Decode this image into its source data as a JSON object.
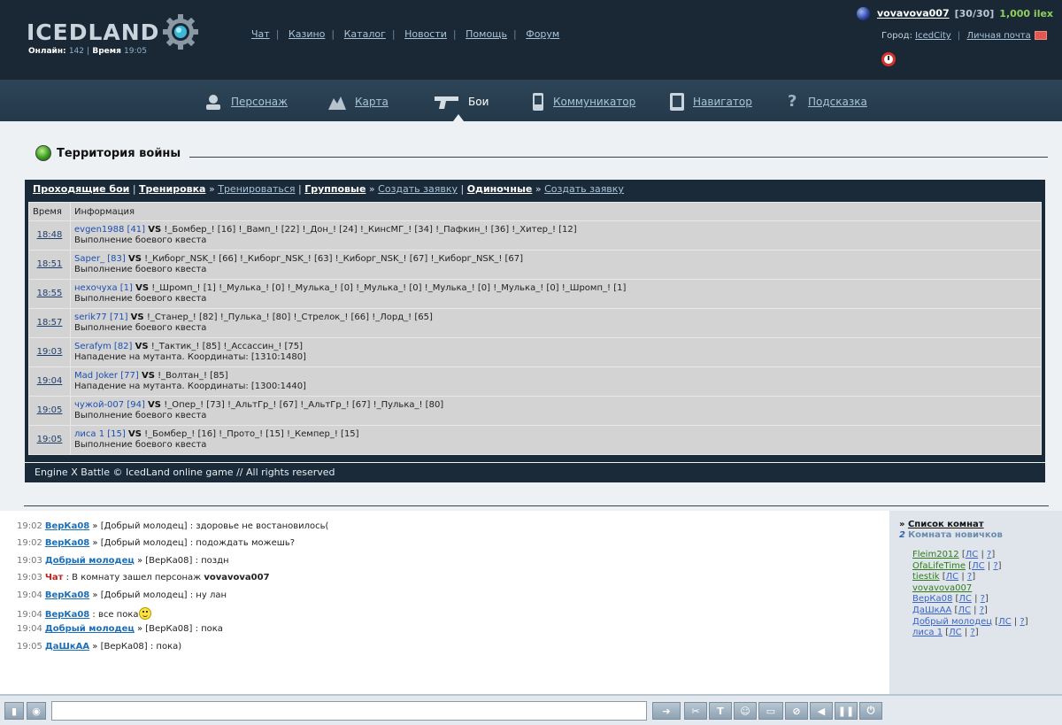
{
  "header": {
    "logo_text": "ICEDLAND",
    "online_label": "Онлайн:",
    "online_count": "142",
    "time_label": "Время",
    "time_value": "19:05",
    "links": [
      "Чат",
      "Казино",
      "Каталог",
      "Новости",
      "Помощь",
      "Форум"
    ],
    "user": {
      "name": "vovavova007",
      "hp": "[30/30]",
      "money": "1,000 ilex",
      "city_label": "Город:",
      "city": "IcedCity",
      "mail_link": "Личная почта"
    }
  },
  "nav": {
    "items": [
      {
        "label": "Персонаж",
        "icon": "character-icon",
        "active": false
      },
      {
        "label": "Карта",
        "icon": "map-icon",
        "active": false
      },
      {
        "label": "Бои",
        "icon": "gun-icon",
        "active": true
      },
      {
        "label": "Коммуникатор",
        "icon": "communicator-icon",
        "active": false
      },
      {
        "label": "Навигатор",
        "icon": "navigator-icon",
        "active": false
      },
      {
        "label": "Подсказка",
        "icon": "help-icon",
        "active": false
      }
    ]
  },
  "main": {
    "title": "Территория войны",
    "tabs": {
      "current": "Проходящие бои",
      "training": "Тренировка",
      "train_link": "Тренироваться",
      "group": "Групповые",
      "group_create": "Создать заявку",
      "single": "Одиночные",
      "single_create": "Создать заявку"
    },
    "table": {
      "headers": [
        "Время",
        "Информация"
      ],
      "rows": [
        {
          "time": "18:48",
          "attacker": "evgen1988 [41]",
          "vs": "VS",
          "defenders": "!_Бомбер_! [16] !_Вамп_! [22] !_Дон_! [24] !_КинсМГ_! [34] !_Пафкин_! [36] !_Хитер_! [12]",
          "desc": "Выполнение боевого квеста"
        },
        {
          "time": "18:51",
          "attacker": "Saper_ [83]",
          "vs": "VS",
          "defenders": "!_Киборг_NSK_! [66] !_Киборг_NSK_! [63] !_Киборг_NSK_! [67] !_Киборг_NSK_! [67]",
          "desc": "Выполнение боевого квеста"
        },
        {
          "time": "18:55",
          "attacker": "нехочуха [1]",
          "vs": "VS",
          "defenders": "!_Шромп_! [1] !_Мулька_! [0] !_Мулька_! [0] !_Мулька_! [0] !_Мулька_! [0] !_Мулька_! [0] !_Шромп_! [1]",
          "desc": "Выполнение боевого квеста"
        },
        {
          "time": "18:57",
          "attacker": "serik77 [71]",
          "vs": "VS",
          "defenders": "!_Станер_! [82] !_Пулька_! [80] !_Стрелок_! [66] !_Лорд_! [65]",
          "desc": "Выполнение боевого квеста"
        },
        {
          "time": "19:03",
          "attacker": "Serafym [82]",
          "vs": "VS",
          "defenders": "!_Тактик_! [85] !_Ассассин_! [75]",
          "desc": "Нападение на мутанта. Координаты: [1310:1480]"
        },
        {
          "time": "19:04",
          "attacker": "Mad Joker [77]",
          "vs": "VS",
          "defenders": "!_Волтан_! [85]",
          "desc": "Нападение на мутанта. Координаты: [1300:1440]"
        },
        {
          "time": "19:05",
          "attacker": "чужой-007 [94]",
          "vs": "VS",
          "defenders": "!_Опер_! [73] !_АльтГр_! [67] !_АльтГр_! [67] !_Пулька_! [80]",
          "desc": "Выполнение боевого квеста"
        },
        {
          "time": "19:05",
          "attacker": "лиса 1 [15]",
          "vs": "VS",
          "defenders": "!_Бомбер_! [16] !_Прото_! [15] !_Кемпер_! [15]",
          "desc": "Выполнение боевого квеста"
        }
      ]
    },
    "copyright": "Engine X Battle © IcedLand online game // All rights reserved"
  },
  "chat": {
    "messages": [
      {
        "time": "19:02",
        "nick": "ВерКа08",
        "rest": " » [Добрый молодец] : здоровье не востановилось("
      },
      {
        "time": "19:02",
        "nick": "ВерКа08",
        "rest": " » [Добрый молодец] : подождать можешь?"
      },
      {
        "time": "19:03",
        "nick": "Добрый молодец",
        "rest": " » [ВерКа08] : поздн"
      },
      {
        "time": "19:03",
        "sys": "Чат",
        "rest": " : В комнату зашел персонаж ",
        "bold": "vovavova007"
      },
      {
        "time": "19:04",
        "nick": "ВерКа08",
        "rest": " » [Добрый молодец] : ну лан"
      },
      {
        "time": "19:04",
        "nick": "ВерКа08",
        "rest": " : все пока",
        "smiley": true
      },
      {
        "time": "19:04",
        "nick": "Добрый молодец",
        "rest": " » [ВерКа08] : пока"
      },
      {
        "time": "19:05",
        "nick": "ДаШкАА",
        "rest": " » [ВерКа08] : пока)"
      }
    ]
  },
  "rooms": {
    "list_link": "Список комнат",
    "room_number": "2",
    "room_name": "Комната новичков",
    "users": [
      {
        "name": "Fleim2012",
        "color": "green"
      },
      {
        "name": "OfaLifeTime",
        "color": "green"
      },
      {
        "name": "tiestik",
        "color": "green"
      },
      {
        "name": "vovavova007",
        "color": "green",
        "no_links": true
      },
      {
        "name": "ВерКа08",
        "color": "blue"
      },
      {
        "name": "ДаШкАА",
        "color": "blue"
      },
      {
        "name": "Добрый молодец",
        "color": "blue"
      },
      {
        "name": "лиса 1",
        "color": "blue"
      }
    ],
    "ls_label": "ЛС",
    "q_label": "?"
  },
  "colors": {
    "header_bg": "#1a2836",
    "accent_green": "#8fd05a",
    "link_blue": "#1b6fb8",
    "alert_red": "#c0221a"
  }
}
